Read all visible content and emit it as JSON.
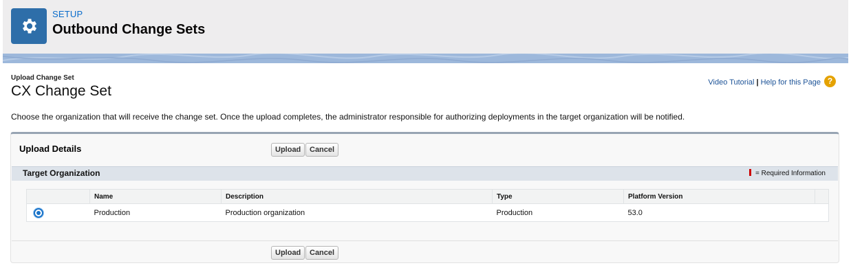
{
  "header": {
    "eyebrow": "SETUP",
    "title": "Outbound Change Sets",
    "icon": "gear-icon"
  },
  "page": {
    "type_label": "Upload Change Set",
    "title": "CX Change Set",
    "help": {
      "video_tutorial": "Video Tutorial",
      "separator": "|",
      "help_page": "Help for this Page",
      "icon_glyph": "?"
    },
    "instructions": "Choose the organization that will receive the change set. Once the upload completes, the administrator responsible for authorizing deployments in the target organization will be notified."
  },
  "block": {
    "title": "Upload Details",
    "upload_label": "Upload",
    "cancel_label": "Cancel",
    "section": {
      "title": "Target Organization",
      "required_text": "= Required Information"
    },
    "table": {
      "columns": [
        "Name",
        "Description",
        "Type",
        "Platform Version"
      ],
      "rows": [
        {
          "selected": true,
          "name": "Production",
          "description": "Production organization",
          "type": "Production",
          "platform_version": "53.0"
        }
      ]
    }
  },
  "colors": {
    "accent": "#2e6ea9",
    "link": "#0a6ccb",
    "required": "#cc0000",
    "help_icon": "#e5a200"
  }
}
